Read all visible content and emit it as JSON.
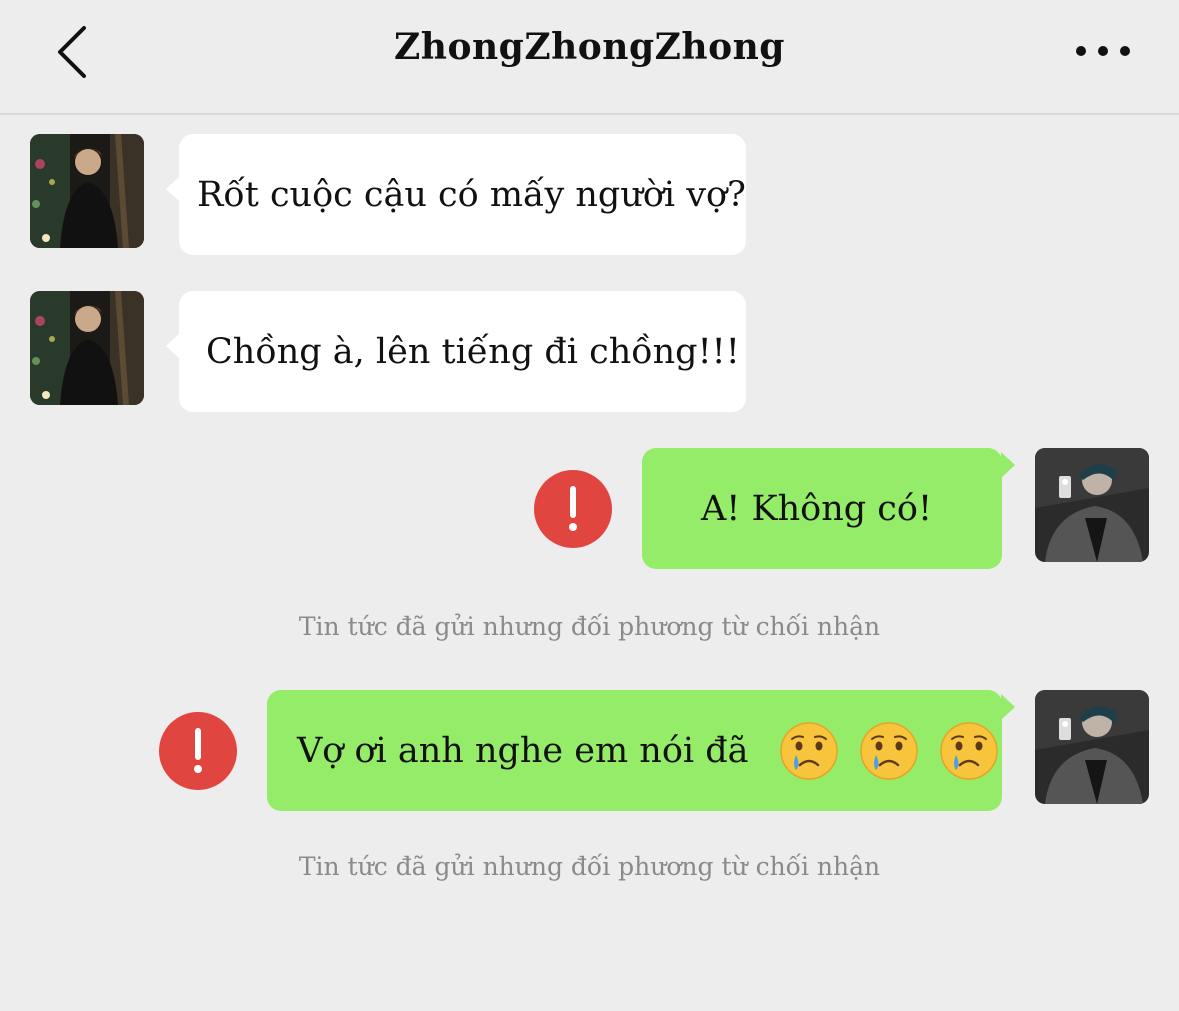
{
  "header": {
    "title": "ZhongZhongZhong"
  },
  "messages": [
    {
      "side": "in",
      "text": "Rốt cuộc cậu có mấy người vợ?"
    },
    {
      "side": "in",
      "text": "Chồng à, lên tiếng đi chồng!!!"
    },
    {
      "side": "out",
      "text": "A! Không có!",
      "status": "Tin tức đã gửi nhưng đối phương từ chối nhận"
    },
    {
      "side": "out",
      "text": "Vợ ơi anh nghe em nói đã",
      "emoji": [
        "crying-face-emoji",
        "crying-face-emoji",
        "crying-face-emoji"
      ],
      "status": "Tin tức đã gửi nhưng đối phương từ chối nhận"
    }
  ],
  "icons": {
    "back": "chevron-left-icon",
    "more": "ellipsis-icon",
    "error": "exclamation-icon"
  },
  "colors": {
    "background": "#ededed",
    "incoming_bubble": "#ffffff",
    "outgoing_bubble": "#95ec69",
    "error": "#e0453f",
    "status_text": "#8a8a8a"
  }
}
